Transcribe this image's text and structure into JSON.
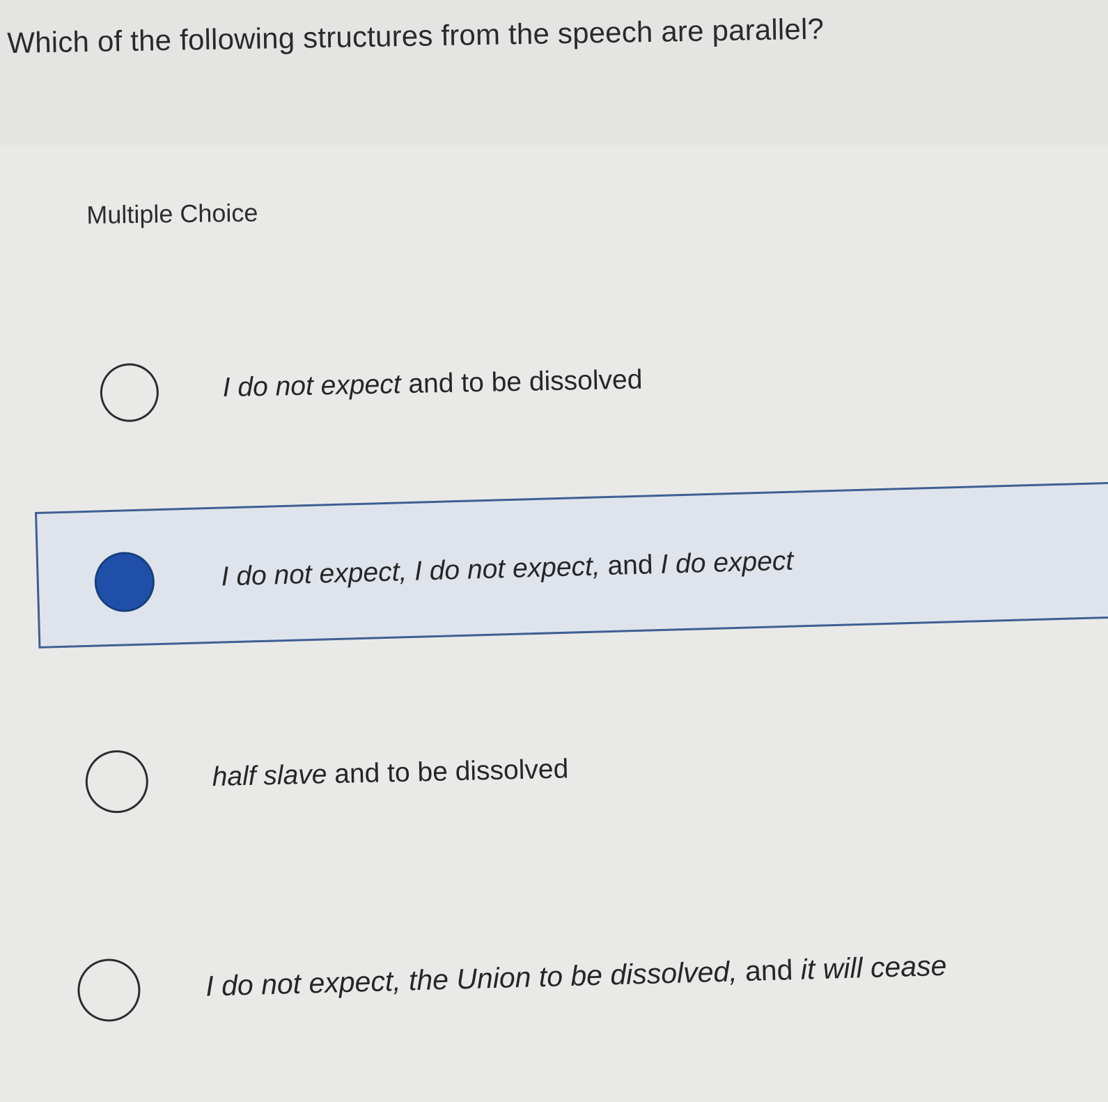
{
  "question": {
    "text": "Which of the following structures from the speech are parallel?"
  },
  "question_type": "Multiple Choice",
  "options": [
    {
      "italic": "I do not expect",
      "rest": " and to be dissolved",
      "selected": false
    },
    {
      "italic": "I do not expect, I do not expect,",
      "rest": " and ",
      "italic2": "I do expect",
      "selected": true
    },
    {
      "italic": "half slave",
      "rest": " and to be dissolved",
      "selected": false
    },
    {
      "italic": "I do not expect, the Union to be dissolved,",
      "rest": " and ",
      "italic2": "it will cease",
      "selected": false
    }
  ],
  "colors": {
    "selected_fill": "#1f4fa8",
    "selected_border": "#3f5f92",
    "selected_background": "#dfe4ec"
  }
}
